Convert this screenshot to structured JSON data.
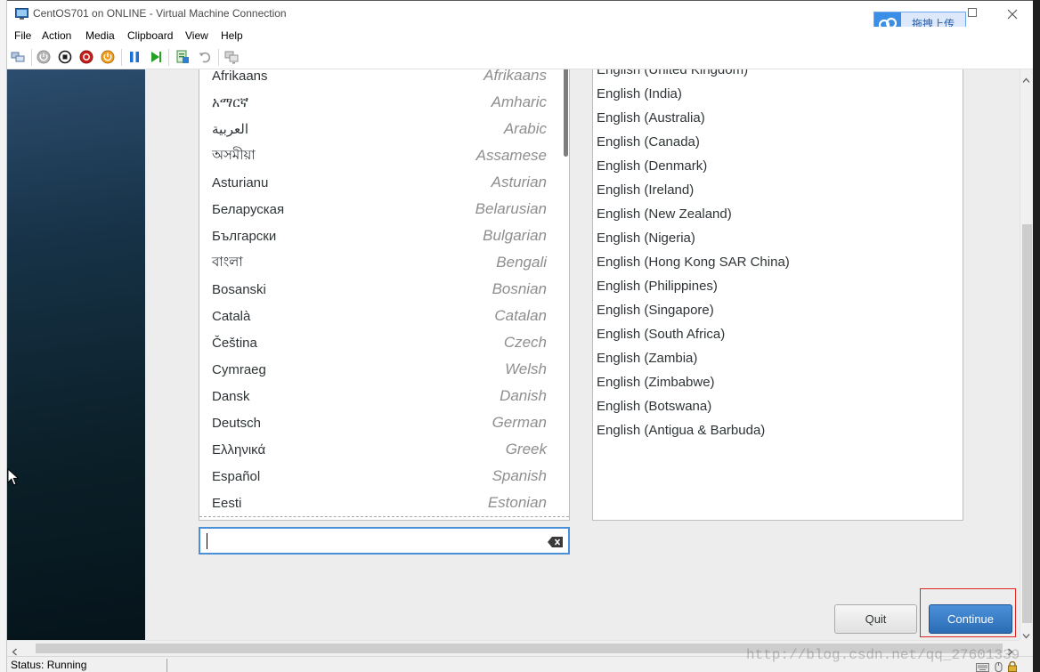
{
  "window": {
    "title": "CentOS701 on ONLINE - Virtual Machine Connection",
    "upload_label": "拖拽上传",
    "icons": [
      "vm-connection-icon",
      "cloud-upload-icon",
      "maximize-icon",
      "close-icon"
    ]
  },
  "menu": [
    "File",
    "Action",
    "Media",
    "Clipboard",
    "View",
    "Help"
  ],
  "toolbar": {
    "icons": [
      "ctrl-alt-del-icon",
      "start-icon",
      "turn-off-icon",
      "shut-down-icon",
      "save-icon",
      "pause-icon",
      "reset-icon",
      "checkpoint-icon",
      "revert-icon",
      "enhanced-session-icon"
    ]
  },
  "languages": [
    {
      "native": "Afrikaans",
      "english": "Afrikaans"
    },
    {
      "native": "አማርኛ",
      "english": "Amharic"
    },
    {
      "native": "العربية",
      "english": "Arabic"
    },
    {
      "native": "অসমীয়া",
      "english": "Assamese"
    },
    {
      "native": "Asturianu",
      "english": "Asturian"
    },
    {
      "native": "Беларуская",
      "english": "Belarusian"
    },
    {
      "native": "Български",
      "english": "Bulgarian"
    },
    {
      "native": "বাংলা",
      "english": "Bengali"
    },
    {
      "native": "Bosanski",
      "english": "Bosnian"
    },
    {
      "native": "Català",
      "english": "Catalan"
    },
    {
      "native": "Čeština",
      "english": "Czech"
    },
    {
      "native": "Cymraeg",
      "english": "Welsh"
    },
    {
      "native": "Dansk",
      "english": "Danish"
    },
    {
      "native": "Deutsch",
      "english": "German"
    },
    {
      "native": "Ελληνικά",
      "english": "Greek"
    },
    {
      "native": "Español",
      "english": "Spanish"
    },
    {
      "native": "Eesti",
      "english": "Estonian"
    }
  ],
  "locales": [
    "English (United Kingdom)",
    "English (India)",
    "English (Australia)",
    "English (Canada)",
    "English (Denmark)",
    "English (Ireland)",
    "English (New Zealand)",
    "English (Nigeria)",
    "English (Hong Kong SAR China)",
    "English (Philippines)",
    "English (Singapore)",
    "English (South Africa)",
    "English (Zambia)",
    "English (Zimbabwe)",
    "English (Botswana)",
    "English (Antigua & Barbuda)"
  ],
  "search": {
    "value": ""
  },
  "buttons": {
    "quit": "Quit",
    "continue": "Continue"
  },
  "status": {
    "text": "Status: Running",
    "icons": [
      "keyboard-icon",
      "mouse-capture-icon",
      "lock-icon"
    ]
  },
  "watermark": "http://blog.csdn.net/qq_27601339",
  "colors": {
    "sidebar_top": "#2c4d6e",
    "sidebar_bottom": "#06141b",
    "primary_button": "#2c6db5",
    "annotation_outline": "#e02424",
    "focus_border": "#4a90d9"
  }
}
